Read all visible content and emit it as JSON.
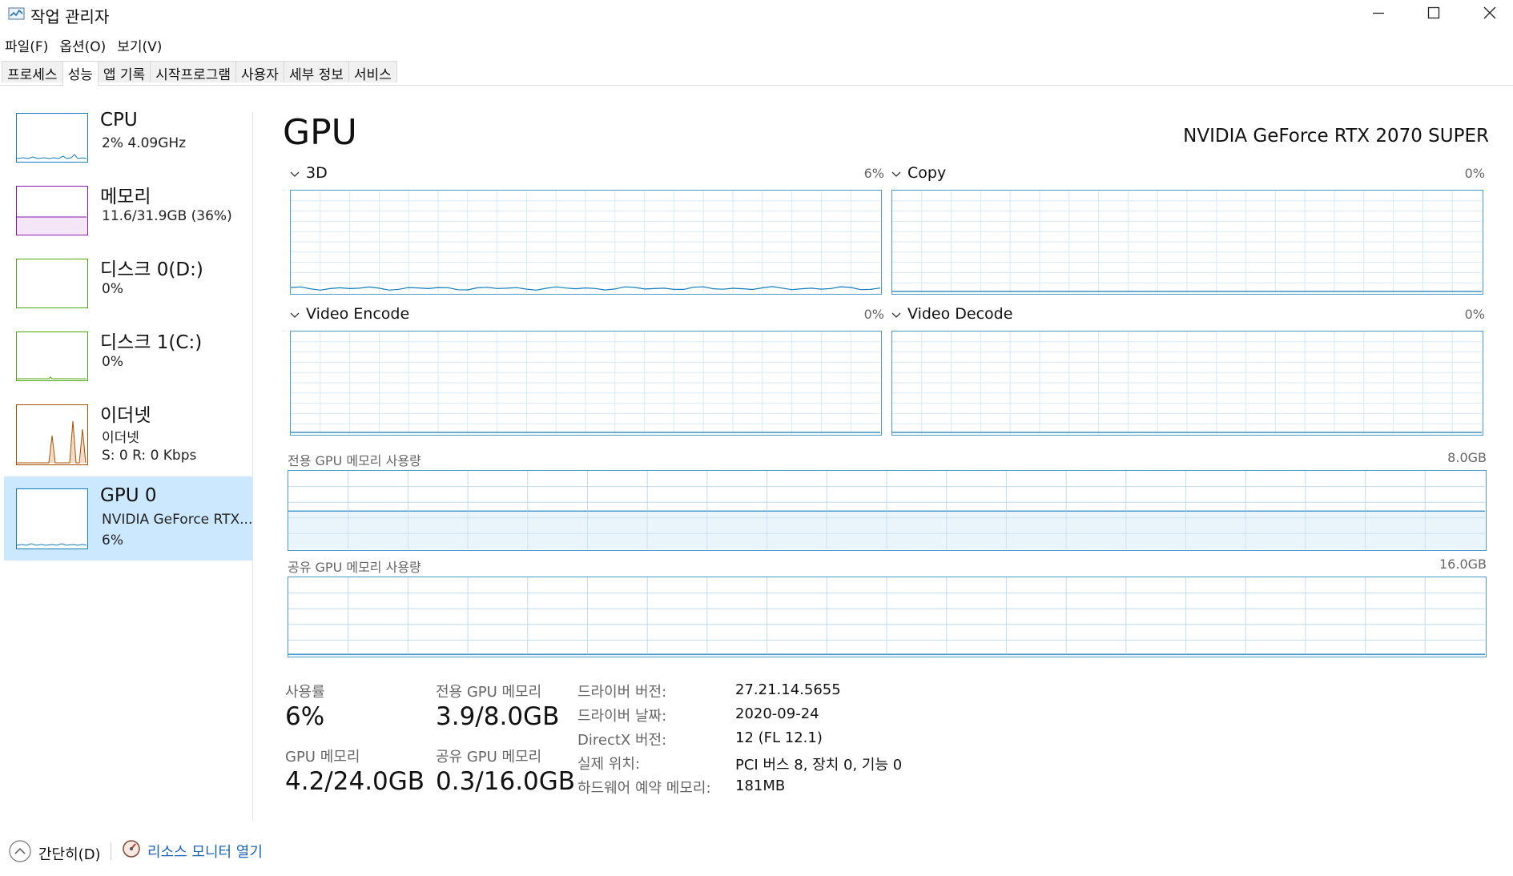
{
  "window": {
    "title": "작업 관리자",
    "icons": {
      "app": "task-manager-icon",
      "minimize": "minimize-icon",
      "maximize": "maximize-icon",
      "close": "close-icon"
    }
  },
  "menu": [
    "파일(F)",
    "옵션(O)",
    "보기(V)"
  ],
  "tabs": [
    "프로세스",
    "성능",
    "앱 기록",
    "시작프로그램",
    "사용자",
    "세부 정보",
    "서비스"
  ],
  "active_tab": "성능",
  "sidebar": {
    "items": [
      {
        "title": "CPU",
        "sub1": "2% 4.09GHz",
        "sub2": "",
        "color": "#117dbb",
        "selected": false
      },
      {
        "title": "메모리",
        "sub1": "11.6/31.9GB (36%)",
        "sub2": "",
        "color": "#8b12ae",
        "selected": false
      },
      {
        "title": "디스크 0(D:)",
        "sub1": "0%",
        "sub2": "",
        "color": "#4da60c",
        "selected": false
      },
      {
        "title": "디스크 1(C:)",
        "sub1": "0%",
        "sub2": "",
        "color": "#4da60c",
        "selected": false
      },
      {
        "title": "이더넷",
        "sub1": "이더넷",
        "sub2": "S: 0 R: 0 Kbps",
        "color": "#a74f01",
        "selected": false
      },
      {
        "title": "GPU 0",
        "sub1": "NVIDIA GeForce RTX...",
        "sub2": "6%",
        "color": "#117dbb",
        "selected": true
      }
    ]
  },
  "main": {
    "title": "GPU",
    "gpu_name": "NVIDIA GeForce RTX 2070 SUPER",
    "engines": [
      {
        "label": "3D",
        "percent": "6%",
        "usage": 0.06
      },
      {
        "label": "Copy",
        "percent": "0%",
        "usage": 0.0
      },
      {
        "label": "Video Encode",
        "percent": "0%",
        "usage": 0.0
      },
      {
        "label": "Video Decode",
        "percent": "0%",
        "usage": 0.0
      }
    ],
    "dedicated_memory": {
      "label": "전용 GPU 메모리 사용량",
      "max": "8.0GB",
      "used_fraction": 0.4875
    },
    "shared_memory": {
      "label": "공유 GPU 메모리 사용량",
      "max": "16.0GB",
      "used_fraction": 0.019
    },
    "stats": {
      "utilization": {
        "label": "사용률",
        "value": "6%"
      },
      "dedicated": {
        "label": "전용 GPU 메모리",
        "value": "3.9/8.0GB"
      },
      "gpu_memory": {
        "label": "GPU 메모리",
        "value": "4.2/24.0GB"
      },
      "shared": {
        "label": "공유 GPU 메모리",
        "value": "0.3/16.0GB"
      }
    },
    "info": [
      {
        "key": "드라이버 버전:",
        "value": "27.21.14.5655"
      },
      {
        "key": "드라이버 날짜:",
        "value": "2020-09-24"
      },
      {
        "key": "DirectX 버전:",
        "value": "12 (FL 12.1)"
      },
      {
        "key": "실제 위치:",
        "value": "PCI 버스 8, 장치 0, 기능 0"
      },
      {
        "key": "하드웨어 예약 메모리:",
        "value": "181MB"
      }
    ]
  },
  "footer": {
    "fewer_details": "간단히(D)",
    "resource_monitor": "리소스 모니터 열기",
    "icons": {
      "collapse": "chevron-up-icon",
      "resource": "resource-monitor-icon"
    }
  },
  "colors": {
    "accent": "#117dbb",
    "selected_bg": "#cce8ff",
    "graph_border": "#4a9bc9",
    "link": "#1a63b8"
  }
}
